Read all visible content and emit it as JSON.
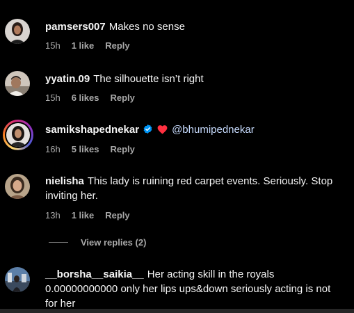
{
  "comments": [
    {
      "username": "pamsers007",
      "text": "Makes no sense",
      "time": "15h",
      "likes": "1 like",
      "reply": "Reply"
    },
    {
      "username": "yyatin.09",
      "text": "The silhouette isn’t right",
      "time": "15h",
      "likes": "6 likes",
      "reply": "Reply"
    },
    {
      "username": "samikshapednekar",
      "mention": "@bhumipednekar",
      "time": "16h",
      "likes": "5 likes",
      "reply": "Reply"
    },
    {
      "username": "nielisha",
      "text": "This lady is ruining red carpet events. Seriously. Stop inviting her.",
      "time": "13h",
      "likes": "1 like",
      "reply": "Reply",
      "view_replies": "View replies (2)"
    },
    {
      "username": "__borsha__saikia__",
      "text": "Her acting skill in the royals 0.00000000000 only her lips ups&down seriously acting is not for her"
    }
  ],
  "colors": {
    "background": "#000000",
    "text": "#f5f5f5",
    "meta": "#a8a8a8",
    "mention": "#c8dcff",
    "verified": "#0095f6",
    "heart": "#ff3040"
  }
}
